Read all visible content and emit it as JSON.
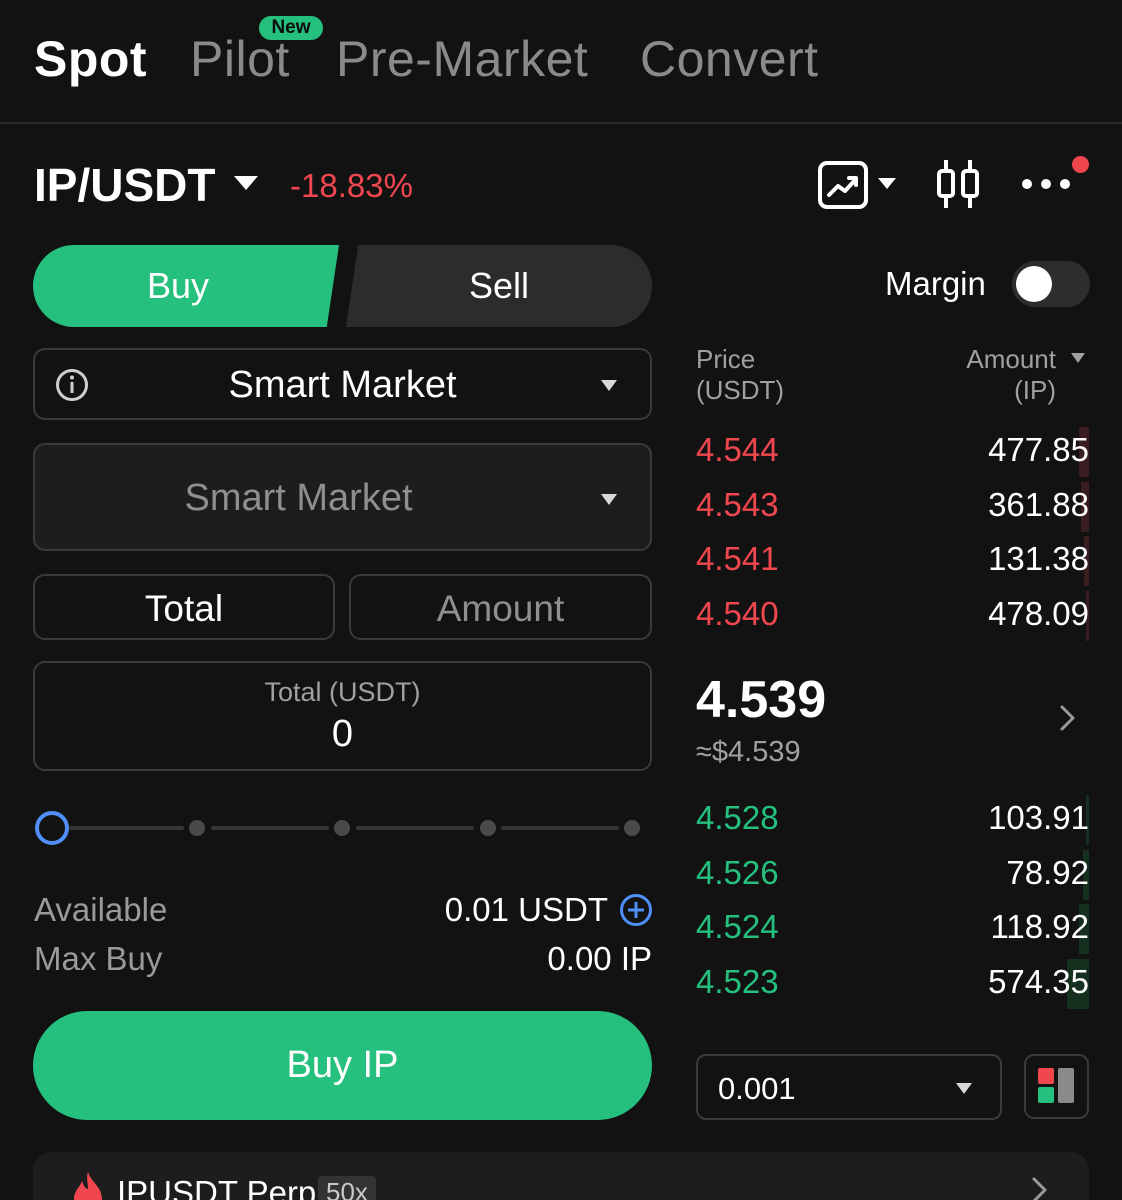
{
  "tabs": {
    "spot": "Spot",
    "pilot": "Pilot",
    "new_badge": "New",
    "premarket": "Pre-Market",
    "convert": "Convert"
  },
  "pair": {
    "symbol": "IP/USDT",
    "change": "-18.83%"
  },
  "toolbar_icons": [
    "chart-icon",
    "candlestick-icon",
    "more-icon"
  ],
  "trade": {
    "buy_label": "Buy",
    "sell_label": "Sell",
    "margin_label": "Margin",
    "margin_enabled": false,
    "order_type": "Smart Market",
    "price_field": "Smart Market",
    "mode_total": "Total",
    "mode_amount": "Amount",
    "total_label": "Total (USDT)",
    "total_value": "0",
    "slider_percent": 0,
    "available_label": "Available",
    "available_value": "0.01 USDT",
    "max_buy_label": "Max Buy",
    "max_buy_value": "0.00 IP",
    "submit_label": "Buy IP"
  },
  "orderbook": {
    "price_header": "Price",
    "price_unit": "(USDT)",
    "amount_header": "Amount",
    "amount_unit": "(IP)",
    "asks": [
      {
        "price": "4.544",
        "amount": "477.85"
      },
      {
        "price": "4.543",
        "amount": "361.88"
      },
      {
        "price": "4.541",
        "amount": "131.38"
      },
      {
        "price": "4.540",
        "amount": "478.09"
      }
    ],
    "last_price": "4.539",
    "last_usd": "≈$4.539",
    "bids": [
      {
        "price": "4.528",
        "amount": "103.91"
      },
      {
        "price": "4.526",
        "amount": "78.92"
      },
      {
        "price": "4.524",
        "amount": "118.92"
      },
      {
        "price": "4.523",
        "amount": "574.35"
      }
    ],
    "precision": "0.001"
  },
  "perp": {
    "label": "IPUSDT Perp",
    "leverage": "50x"
  },
  "colors": {
    "green": "#25c07d",
    "red": "#f0474f",
    "blue": "#4f8ff7",
    "background": "#121212"
  }
}
